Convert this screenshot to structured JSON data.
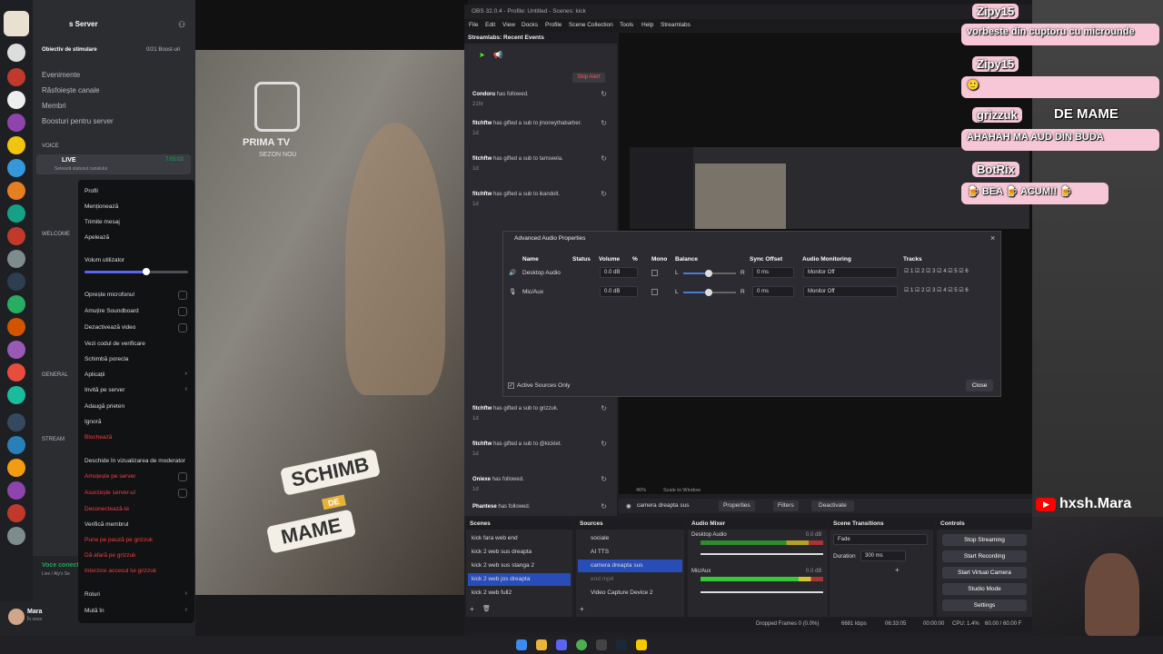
{
  "discord": {
    "server_name": "s Server",
    "boost_goal": "Obiectiv de stimulare",
    "boost_count": "0/21 Boost-uri",
    "channels": [
      "Evenimente",
      "Răsfoiește canale",
      "Membri",
      "Boosturi pentru server"
    ],
    "voice_header": "VOICE",
    "live_label": "LIVE",
    "live_time": "7:05:02",
    "status_hint": "Setează statusul canalului",
    "welcome_header": "WELCOME",
    "general_header": "GENERAL",
    "stream_header": "STREAM",
    "voice_connected": "Voce conectată",
    "voice_sub": "Live / Aly's Se",
    "user_name": "Mara",
    "user_status": "În voce",
    "ctx": {
      "profile": "Profil",
      "mention": "Menționează",
      "send_message": "Trimite mesaj",
      "call": "Apelează",
      "volume": "Volum utilizator",
      "volume_level": 0.6,
      "mute_mic": "Oprește microfonul",
      "mute_soundboard": "Amuțire Soundboard",
      "disable_video": "Dezactivează video",
      "verify_code": "Vezi codul de verificare",
      "nickname": "Schimbă porecla",
      "apps": "Aplicații",
      "invite": "Invită pe server",
      "add_friend": "Adaugă prieten",
      "ignore": "Ignoră",
      "block": "Blochează",
      "mod_view": "Deschide în vizualizarea de moderator",
      "server_mute": "Amuțește pe server",
      "server_deafen": "Asurzește server-ul",
      "disconnect": "Deconectează-te",
      "verify_member": "Verifică membrul",
      "pause": "Pune pe pauză pe grizzuk",
      "kick": "Dă afară pe grizzuk",
      "ban": "Interzice accesul lui grizzuk",
      "roles": "Roluri",
      "move_to": "Mută în"
    }
  },
  "video": {
    "brand": "PRIMA TV",
    "sub": "SEZON NOU",
    "sticker1": "SCHIMB",
    "sticker2": "DE",
    "sticker3": "MAME"
  },
  "obs": {
    "title": "OBS 32.0.4 - Profile: Untitled - Scenes: kick",
    "menu": [
      "File",
      "Edit",
      "View",
      "Docks",
      "Profile",
      "Scene Collection",
      "Tools",
      "Help",
      "Streamlabs"
    ],
    "recent_events_title": "Streamlabs: Recent Events",
    "skip_alert": "Skip Alert",
    "events": [
      {
        "who": "Condoru",
        "what": "has followed.",
        "when": "21hr"
      },
      {
        "who": "fitchftw",
        "what": "has gifted a sub to jmoneythabarber.",
        "when": "1d"
      },
      {
        "who": "fitchftw",
        "what": "has gifted a sub to tamseela.",
        "when": "1d"
      },
      {
        "who": "fitchftw",
        "what": "has gifted a sub to ikandolt.",
        "when": "1d"
      },
      {
        "who": "fitchftw",
        "what": "has gifted a sub to grizzuk.",
        "when": "1d"
      },
      {
        "who": "fitchftw",
        "what": "has gifted a sub to @kicklet.",
        "when": "1d"
      },
      {
        "who": "Oniexe",
        "what": "has followed.",
        "when": "1d"
      },
      {
        "who": "Phantese",
        "what": "has followed.",
        "when": ""
      }
    ],
    "dialog": {
      "title": "Advanced Audio Properties",
      "headers": [
        "Name",
        "Status",
        "Volume",
        "%",
        "Mono",
        "Balance",
        "Sync Offset",
        "Audio Monitoring",
        "Tracks"
      ],
      "rows": [
        {
          "name": "Desktop Audio",
          "volume": "0.0 dB",
          "sync": "0 ms",
          "monitoring": "Monitor Off"
        },
        {
          "name": "Mic/Aux",
          "volume": "0.0 dB",
          "sync": "0 ms",
          "monitoring": "Monitor Off"
        }
      ],
      "balance_l": "L",
      "balance_r": "R",
      "track_nums": [
        "1",
        "2",
        "3",
        "4",
        "5",
        "6"
      ],
      "active_only": "Active Sources Only",
      "close": "Close"
    },
    "zoom": "46%",
    "scale": "Scale to Window",
    "source_selected": "camera dreapta sus",
    "properties": "Properties",
    "filters": "Filters",
    "deactivate": "Deactivate",
    "scenes_title": "Scenes",
    "scenes": [
      "kick fara web end",
      "kick 2 web sus dreapta",
      "kick 2 web sus stanga 2",
      "kick 2 web jos dreapta",
      "kick 2 web full2"
    ],
    "sources_title": "Sources",
    "sources": [
      "sociale",
      "AI TTS",
      "camera dreapta sus",
      "end.mp4",
      "Video Capture Device 2"
    ],
    "mixer_title": "Audio Mixer",
    "mixer": [
      {
        "name": "Desktop Audio",
        "db": "0.0 dB"
      },
      {
        "name": "Mic/Aux",
        "db": "0.0 dB"
      }
    ],
    "transitions_title": "Scene Transitions",
    "transition": "Fade",
    "duration_label": "Duration",
    "duration": "300 ms",
    "controls_title": "Controls",
    "controls": [
      "Stop Streaming",
      "Start Recording",
      "Start Virtual Camera",
      "Studio Mode",
      "Settings"
    ],
    "status": {
      "dropped": "Dropped Frames 0 (0.0%)",
      "kbps": "6681 kbps",
      "stream_time": "06:33:05",
      "rec_time": "00:00:00",
      "cpu": "CPU: 1.4%",
      "fps": "60.00 / 60.00 F"
    }
  },
  "chat": [
    {
      "nick": "Zipy15",
      "msg": "vorbeste din cuptoru cu microunde"
    },
    {
      "nick": "Zipy15",
      "msg": "🙂"
    },
    {
      "nick": "grizzuk",
      "tag": "DE MAME",
      "msg": "AHAHAH MA AUD DIN BUDA"
    },
    {
      "nick": "BotRix",
      "msg": "🍺 BEA 🍺 ACUM!! 🍺"
    }
  ],
  "youtube_handle": "hxsh.Mara",
  "colors": {
    "accent": "#284cb8",
    "live_red": "#f23f42",
    "chat_pink": "#f7c7d8",
    "obs_bg": "#1f1f23"
  }
}
